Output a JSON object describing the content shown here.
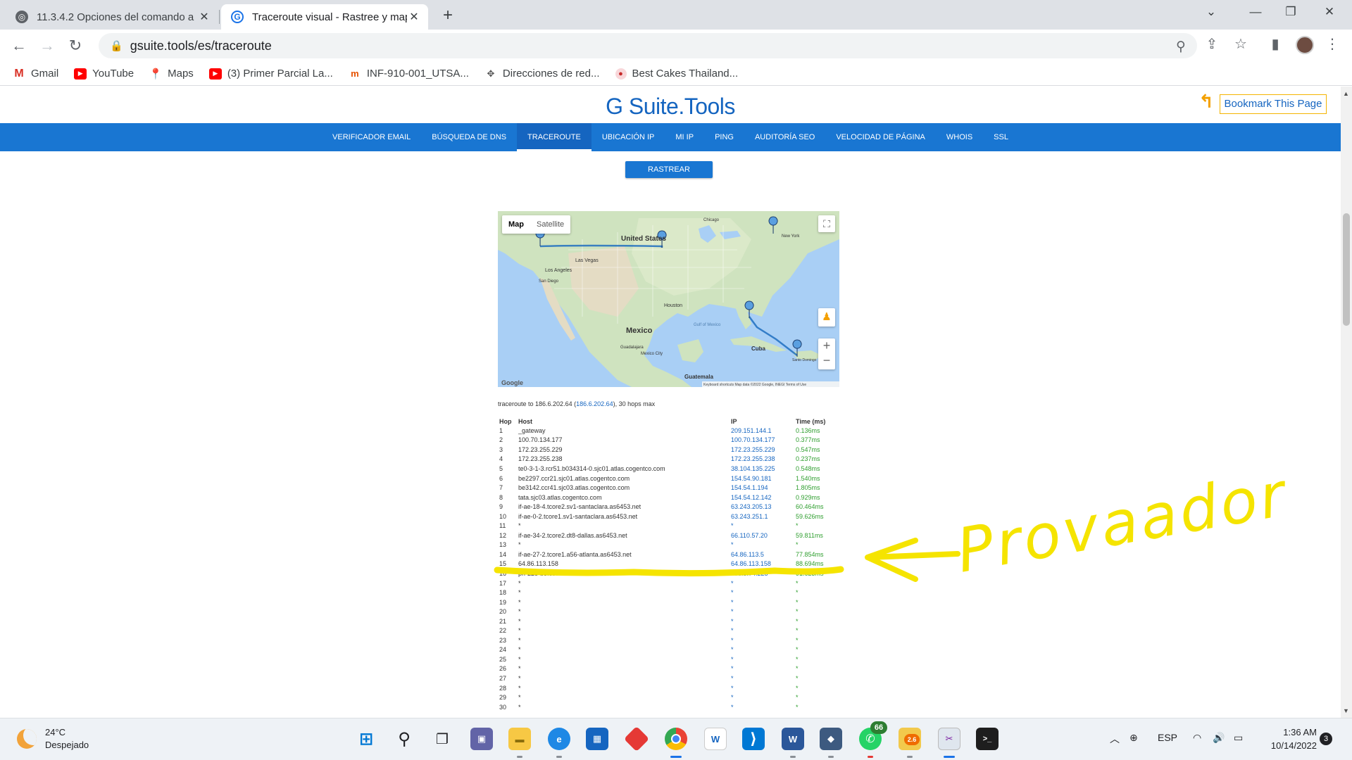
{
  "browser": {
    "tabs": [
      {
        "title": "11.3.4.2 Opciones del comando a",
        "close": "✕"
      },
      {
        "title": "Traceroute visual - Rastree y map",
        "close": "✕"
      }
    ],
    "new_tab": "+",
    "url": "gsuite.tools/es/traceroute",
    "bookmarks": [
      {
        "label": "Gmail",
        "icon": "gmail-icon"
      },
      {
        "label": "YouTube",
        "icon": "youtube-icon"
      },
      {
        "label": "Maps",
        "icon": "maps-icon"
      },
      {
        "label": "(3) Primer Parcial La...",
        "icon": "youtube-icon"
      },
      {
        "label": "INF-910-001_UTSA...",
        "icon": "utsa-icon"
      },
      {
        "label": "Direcciones de red...",
        "icon": "network-icon"
      },
      {
        "label": "Best Cakes Thailand...",
        "icon": "cake-icon"
      }
    ]
  },
  "site": {
    "brand": "G Suite.Tools",
    "bookmark_button": "Bookmark This Page",
    "nav": [
      "VERIFICADOR EMAIL",
      "BÚSQUEDA DE DNS",
      "TRACEROUTE",
      "UBICACIÓN IP",
      "MI IP",
      "PING",
      "AUDITORÍA SEO",
      "VELOCIDAD DE PÁGINA",
      "WHOIS",
      "SSL"
    ],
    "nav_active": "TRACEROUTE",
    "trace_button": "RASTREAR"
  },
  "map": {
    "type_map": "Map",
    "type_satellite": "Satellite",
    "labels": {
      "us": "United States",
      "mexico": "Mexico",
      "cuba": "Cuba",
      "guatemala": "Guatemala",
      "houston": "Houston",
      "los_angeles": "Los Angeles",
      "las_vegas": "Las Vegas",
      "san_diego": "San Diego",
      "new_york": "New York",
      "chicago": "Chicago",
      "mexico_city": "Mexico City",
      "guadalajara": "Guadalajara",
      "gulf": "Gulf of Mexico",
      "santo_domingo": "Santo Domingo",
      "google": "Google",
      "attribution": "Keyboard shortcuts  Map data ©2022 Google, INEGI  Terms of Use"
    }
  },
  "trace": {
    "summary_prefix": "traceroute to 186.6.202.64 (",
    "summary_ip": "186.6.202.64",
    "summary_suffix": "), 30 hops max",
    "headers": {
      "hop": "Hop",
      "host": "Host",
      "ip": "IP",
      "time": "Time (ms)"
    },
    "hops": [
      {
        "hop": "1",
        "host": "_gateway",
        "ip": "209.151.144.1",
        "time": "0.136ms"
      },
      {
        "hop": "2",
        "host": "100.70.134.177",
        "ip": "100.70.134.177",
        "time": "0.377ms"
      },
      {
        "hop": "3",
        "host": "172.23.255.229",
        "ip": "172.23.255.229",
        "time": "0.547ms"
      },
      {
        "hop": "4",
        "host": "172.23.255.238",
        "ip": "172.23.255.238",
        "time": "0.237ms"
      },
      {
        "hop": "5",
        "host": "te0-3-1-3.rcr51.b034314-0.sjc01.atlas.cogentco.com",
        "ip": "38.104.135.225",
        "time": "0.548ms"
      },
      {
        "hop": "6",
        "host": "be2297.ccr21.sjc01.atlas.cogentco.com",
        "ip": "154.54.90.181",
        "time": "1.540ms"
      },
      {
        "hop": "7",
        "host": "be3142.ccr41.sjc03.atlas.cogentco.com",
        "ip": "154.54.1.194",
        "time": "1.805ms"
      },
      {
        "hop": "8",
        "host": "tata.sjc03.atlas.cogentco.com",
        "ip": "154.54.12.142",
        "time": "0.929ms"
      },
      {
        "hop": "9",
        "host": "if-ae-18-4.tcore2.sv1-santaclara.as6453.net",
        "ip": "63.243.205.13",
        "time": "60.464ms"
      },
      {
        "hop": "10",
        "host": "if-ae-0-2.tcore1.sv1-santaclara.as6453.net",
        "ip": "63.243.251.1",
        "time": "59.626ms"
      },
      {
        "hop": "11",
        "host": "*",
        "ip": "*",
        "time": "*"
      },
      {
        "hop": "12",
        "host": "if-ae-34-2.tcore2.dt8-dallas.as6453.net",
        "ip": "66.110.57.20",
        "time": "59.811ms"
      },
      {
        "hop": "13",
        "host": "*",
        "ip": "*",
        "time": "*"
      },
      {
        "hop": "14",
        "host": "if-ae-27-2.tcore1.a56-atlanta.as6453.net",
        "ip": "64.86.113.5",
        "time": "77.854ms"
      },
      {
        "hop": "15",
        "host": "64.86.113.158",
        "ip": "64.86.113.158",
        "time": "88.694ms"
      },
      {
        "hop": "16",
        "host": "pri-228-b3.codetel.net.do",
        "ip": "196.3.74.228",
        "time": "91.623ms"
      },
      {
        "hop": "17",
        "host": "*",
        "ip": "*",
        "time": "*"
      },
      {
        "hop": "18",
        "host": "*",
        "ip": "*",
        "time": "*"
      },
      {
        "hop": "19",
        "host": "*",
        "ip": "*",
        "time": "*"
      },
      {
        "hop": "20",
        "host": "*",
        "ip": "*",
        "time": "*"
      },
      {
        "hop": "21",
        "host": "*",
        "ip": "*",
        "time": "*"
      },
      {
        "hop": "22",
        "host": "*",
        "ip": "*",
        "time": "*"
      },
      {
        "hop": "23",
        "host": "*",
        "ip": "*",
        "time": "*"
      },
      {
        "hop": "24",
        "host": "*",
        "ip": "*",
        "time": "*"
      },
      {
        "hop": "25",
        "host": "*",
        "ip": "*",
        "time": "*"
      },
      {
        "hop": "26",
        "host": "*",
        "ip": "*",
        "time": "*"
      },
      {
        "hop": "27",
        "host": "*",
        "ip": "*",
        "time": "*"
      },
      {
        "hop": "28",
        "host": "*",
        "ip": "*",
        "time": "*"
      },
      {
        "hop": "29",
        "host": "*",
        "ip": "*",
        "time": "*"
      },
      {
        "hop": "30",
        "host": "*",
        "ip": "*",
        "time": "*"
      }
    ],
    "highlighted_hop": "16"
  },
  "annotation": {
    "text": "Provaador",
    "color": "#f5e400"
  },
  "taskbar": {
    "temperature": "24°C",
    "condition": "Despejado",
    "whatsapp_badge": "66",
    "app_badge": "2.6",
    "language": "ESP",
    "time": "1:36 AM",
    "date": "10/14/2022",
    "notifications": "3"
  }
}
